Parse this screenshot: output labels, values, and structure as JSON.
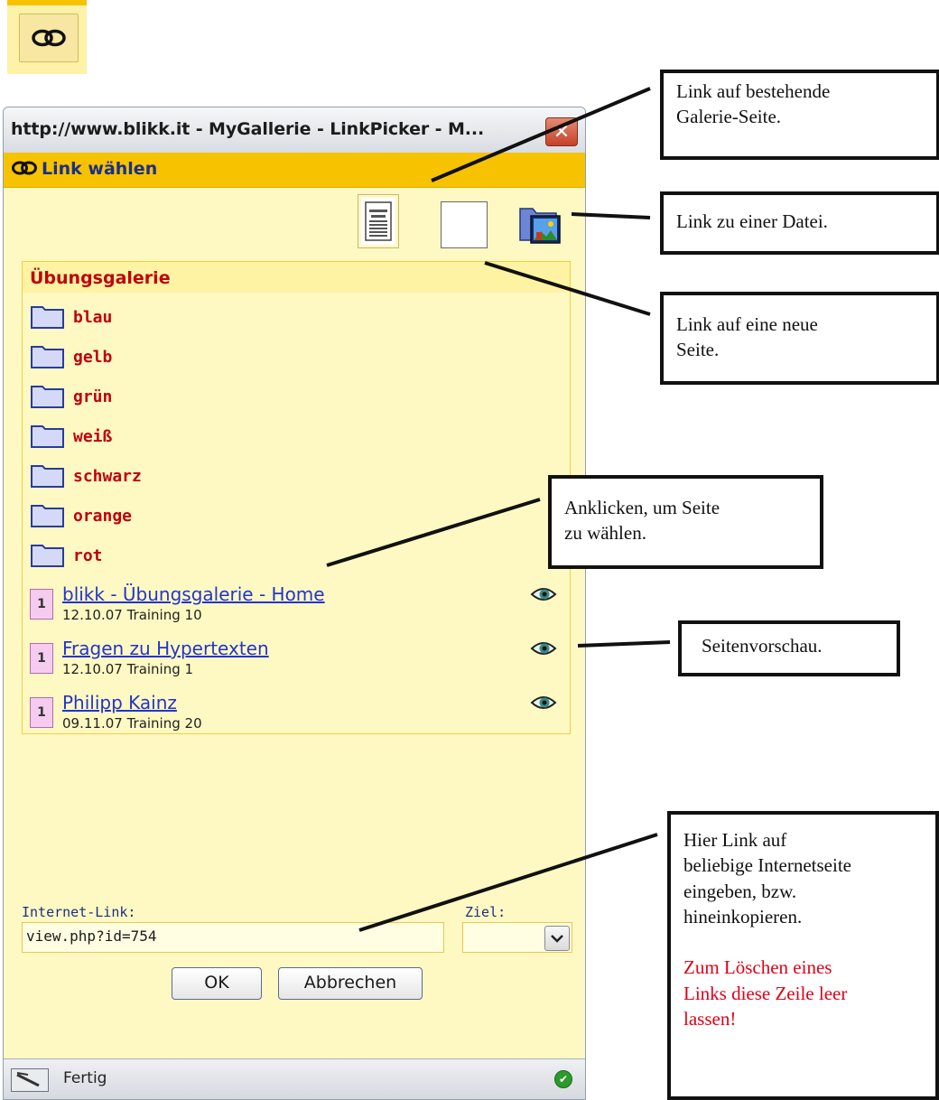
{
  "window": {
    "title": "http://www.blikk.it - MyGallerie - LinkPicker - M...",
    "header_title": "Link wählen"
  },
  "gallery": {
    "title": "Übungsgalerie",
    "folders": [
      "blau",
      "gelb",
      "grün",
      "weiß",
      "schwarz",
      "orange",
      "rot"
    ],
    "pages": [
      {
        "number": "1",
        "title": "blikk - Übungsgalerie - Home",
        "meta": "12.10.07 Training 10"
      },
      {
        "number": "1",
        "title": "Fragen zu Hypertexten",
        "meta": "12.10.07 Training 1"
      },
      {
        "number": "1",
        "title": "Philipp Kainz",
        "meta": "09.11.07 Training 20"
      }
    ]
  },
  "form": {
    "link_label": "Internet-Link:",
    "link_value": "view.php?id=754",
    "target_label": "Ziel:",
    "target_value": "",
    "ok_label": "OK",
    "cancel_label": "Abbrechen"
  },
  "status": {
    "text": "Fertig"
  },
  "callouts": {
    "existing_page": [
      "Link auf bestehende",
      "Galerie-Seite."
    ],
    "file_link": [
      "Link zu einer Datei."
    ],
    "new_page": [
      "Link auf eine neue",
      "Seite."
    ],
    "click_page": [
      "Anklicken, um Seite",
      "zu wählen."
    ],
    "preview": [
      "Seitenvorschau."
    ],
    "internet_link": [
      "Hier Link auf",
      "beliebige Internetseite",
      "eingeben, bzw.",
      "hineinkopieren."
    ],
    "delete_hint": [
      "Zum Löschen eines",
      "Links diese Zeile leer",
      "lassen!"
    ]
  },
  "icons": {
    "link": "link-icon",
    "folder": "folder-icon",
    "eye": "eye-icon",
    "close": "close-icon",
    "page_existing": "page-document-icon",
    "page_new": "blank-page-icon",
    "file": "file-folder-icon",
    "dropdown": "chevron-down-icon",
    "status_ok": "check-circle-icon"
  },
  "colors": {
    "header_yellow": "#f7c200",
    "panel_bg": "#fef9c3",
    "folder_text": "#c0000f",
    "link_blue": "#2235cc",
    "delete_hint_red": "#e00018"
  }
}
